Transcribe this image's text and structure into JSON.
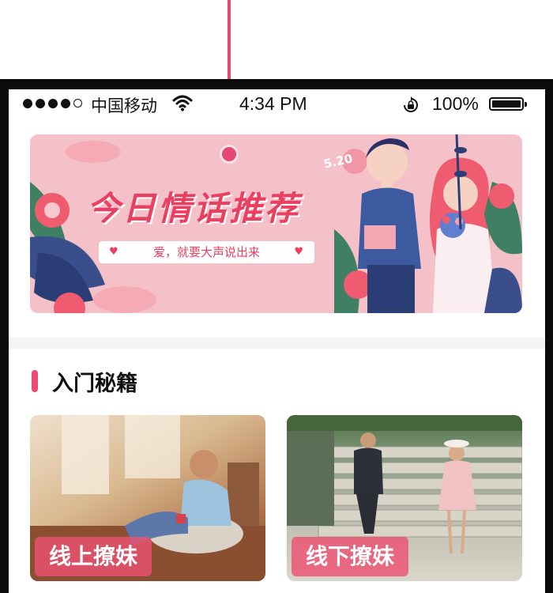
{
  "status_bar": {
    "carrier": "中国移动",
    "time": "4:34 PM",
    "battery": "100%",
    "signal_bars": 4,
    "signal_max": 5,
    "icons": [
      "signal-dots-icon",
      "wifi-icon",
      "rotation-lock-icon",
      "battery-icon"
    ]
  },
  "banner": {
    "title": "今日情话推荐",
    "subtitle": "爱，就要大声说出来",
    "badge": "5.20"
  },
  "section": {
    "title": "入门秘籍"
  },
  "cards": [
    {
      "label": "线上撩妹"
    },
    {
      "label": "线下撩妹"
    }
  ],
  "colors": {
    "accent": "#ec4a74",
    "banner_bg": "#f5c1c8",
    "pointer": "#e44873"
  }
}
